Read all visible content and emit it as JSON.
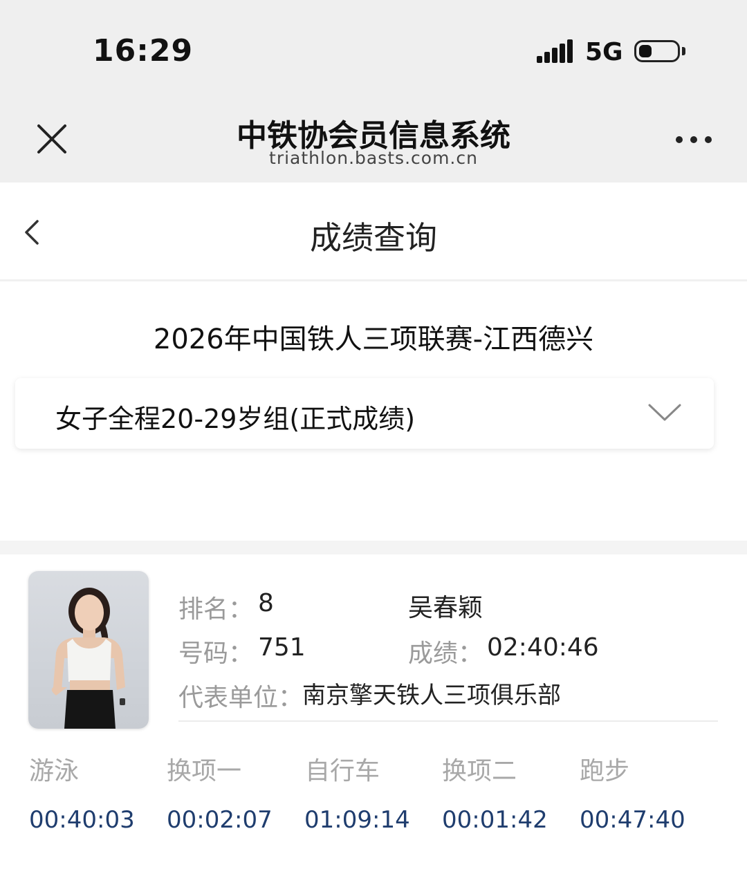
{
  "status_bar": {
    "time": "16:29",
    "network": "5G"
  },
  "header": {
    "title": "中铁协会员信息系统",
    "url": "triathlon.basts.com.cn"
  },
  "nav": {
    "page_title": "成绩查询"
  },
  "event": {
    "title": "2026年中国铁人三项联赛-江西德兴",
    "group_selected": "女子全程20-29岁组(正式成绩)"
  },
  "result": {
    "rank_label": "排名：",
    "rank": "8",
    "name": "吴春颖",
    "bib_label": "号码：",
    "bib": "751",
    "score_label": "成绩：",
    "score": "02:40:46",
    "unit_label": "代表单位：",
    "unit": "南京擎天铁人三项俱乐部",
    "segments": [
      {
        "label": "游泳",
        "time": "00:40:03"
      },
      {
        "label": "换项一",
        "time": "00:02:07"
      },
      {
        "label": "自行车",
        "time": "01:09:14"
      },
      {
        "label": "换项二",
        "time": "00:01:42"
      },
      {
        "label": "跑步",
        "time": "00:47:40"
      }
    ]
  },
  "colors": {
    "header_bg": "#efefef",
    "segment_time": "#1f3d6e",
    "label_gray": "#9a9a9a"
  }
}
